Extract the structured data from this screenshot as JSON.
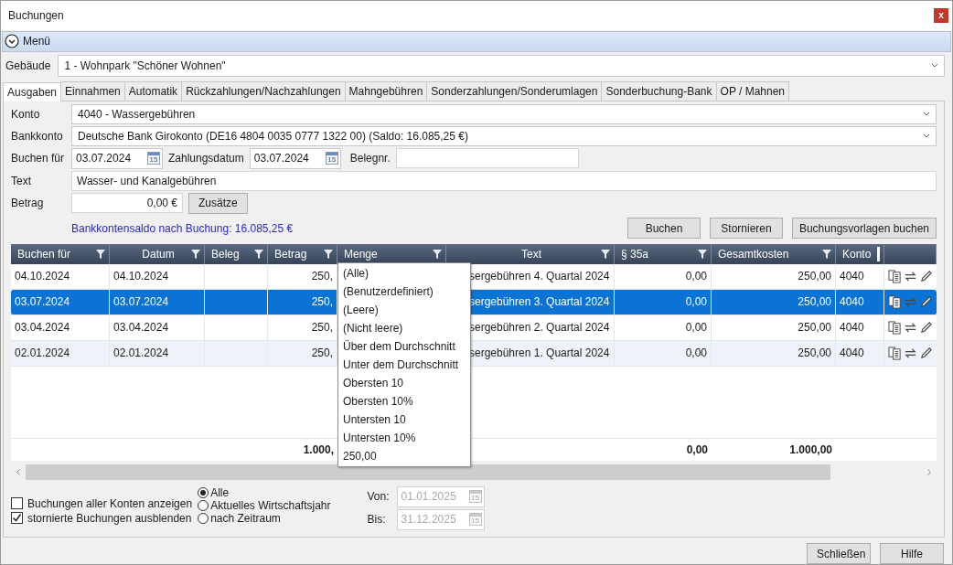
{
  "window": {
    "title": "Buchungen",
    "close": "x"
  },
  "menu": {
    "label": "Menü"
  },
  "gebaeude": {
    "label": "Gebäude",
    "value": "1 - Wohnpark \"Schöner Wohnen\""
  },
  "tabs": [
    {
      "label": "Ausgaben",
      "selected": true
    },
    {
      "label": "Einnahmen",
      "selected": false
    },
    {
      "label": "Automatik",
      "selected": false
    },
    {
      "label": "Rückzahlungen/Nachzahlungen",
      "selected": false
    },
    {
      "label": "Mahngebühren",
      "selected": false
    },
    {
      "label": "Sonderzahlungen/Sonderumlagen",
      "selected": false
    },
    {
      "label": "Sonderbuchung-Bank",
      "selected": false
    },
    {
      "label": "OP / Mahnen",
      "selected": false
    }
  ],
  "form": {
    "konto": {
      "label": "Konto",
      "value": "4040 - Wassergebühren"
    },
    "bankkonto": {
      "label": "Bankkonto",
      "value": "Deutsche Bank Girokonto (DE16 4804 0035 0777 1322 00) (Saldo: 16.085,25 €)"
    },
    "buchen_fuer": {
      "label": "Buchen für",
      "value": "03.07.2024",
      "calendar": "15"
    },
    "zahlungsdatum": {
      "label": "Zahlungsdatum",
      "value": "03.07.2024",
      "calendar": "15"
    },
    "belegnr": {
      "label": "Belegnr."
    },
    "text": {
      "label": "Text",
      "value": "Wasser- und Kanalgebühren"
    },
    "betrag": {
      "label": "Betrag",
      "value": "0,00 €"
    },
    "zusaetze_button": "Zusätze",
    "saldo_note": "Bankkontensaldo nach Buchung: 16.085,25 €"
  },
  "action_buttons": [
    "Buchen",
    "Stornieren",
    "Buchungsvorlagen buchen"
  ],
  "table": {
    "columns": [
      {
        "label": "Buchen für",
        "filter": true
      },
      {
        "label": "Datum",
        "filter": true
      },
      {
        "label": "Beleg",
        "filter": true
      },
      {
        "label": "Betrag",
        "filter": true
      },
      {
        "label": "Menge",
        "filter": true
      },
      {
        "label": "Text",
        "filter": true
      },
      {
        "label": "§ 35a",
        "filter": true
      },
      {
        "label": "Gesamtkosten",
        "filter": true
      },
      {
        "label": "Konto",
        "filter": false
      }
    ],
    "rows": [
      {
        "cells": [
          "04.10.2024",
          "04.10.2024",
          "",
          "250,",
          "",
          "sergebühren 4. Quartal 2024",
          "0,00",
          "250,00",
          "4040"
        ],
        "selected": false
      },
      {
        "cells": [
          "03.07.2024",
          "03.07.2024",
          "",
          "250,",
          "",
          "sergebühren 3. Quartal 2024",
          "0,00",
          "250,00",
          "4040"
        ],
        "selected": true
      },
      {
        "cells": [
          "03.04.2024",
          "03.04.2024",
          "",
          "250,",
          "",
          "sergebühren 2. Quartal 2024",
          "0,00",
          "250,00",
          "4040"
        ],
        "selected": false
      },
      {
        "cells": [
          "02.01.2024",
          "02.01.2024",
          "",
          "250,",
          "",
          "sergebühren 1. Quartal 2024",
          "0,00",
          "250,00",
          "4040"
        ],
        "selected": false
      }
    ],
    "totals": {
      "betrag": "1.000,",
      "p35a": "0,00",
      "gesamtkosten": "1.000,00"
    }
  },
  "filter_menu": {
    "items": [
      "(Alle)",
      "(Benutzerdefiniert)",
      "(Leere)",
      "(Nicht leere)",
      "Über dem Durchschnitt",
      "Unter dem Durchschnitt",
      "Obersten 10",
      "Obersten 10%",
      "Untersten 10",
      "Untersten 10%",
      "250,00"
    ]
  },
  "options": {
    "checkboxes": [
      {
        "label": "Buchungen aller Konten anzeigen",
        "checked": false
      },
      {
        "label": "stornierte Buchungen ausblenden",
        "checked": true
      }
    ],
    "radios": [
      {
        "label": "Alle",
        "selected": true
      },
      {
        "label": "Aktuelles Wirtschaftsjahr",
        "selected": false
      },
      {
        "label": "nach Zeitraum",
        "selected": false
      }
    ],
    "von": {
      "label": "Von:",
      "value": "01.01.2025",
      "calendar": "15",
      "disabled": true
    },
    "bis": {
      "label": "Bis:",
      "value": "31.12.2025",
      "calendar": "15",
      "disabled": true
    }
  },
  "footer_buttons": [
    "Schließen",
    "Hilfe"
  ]
}
